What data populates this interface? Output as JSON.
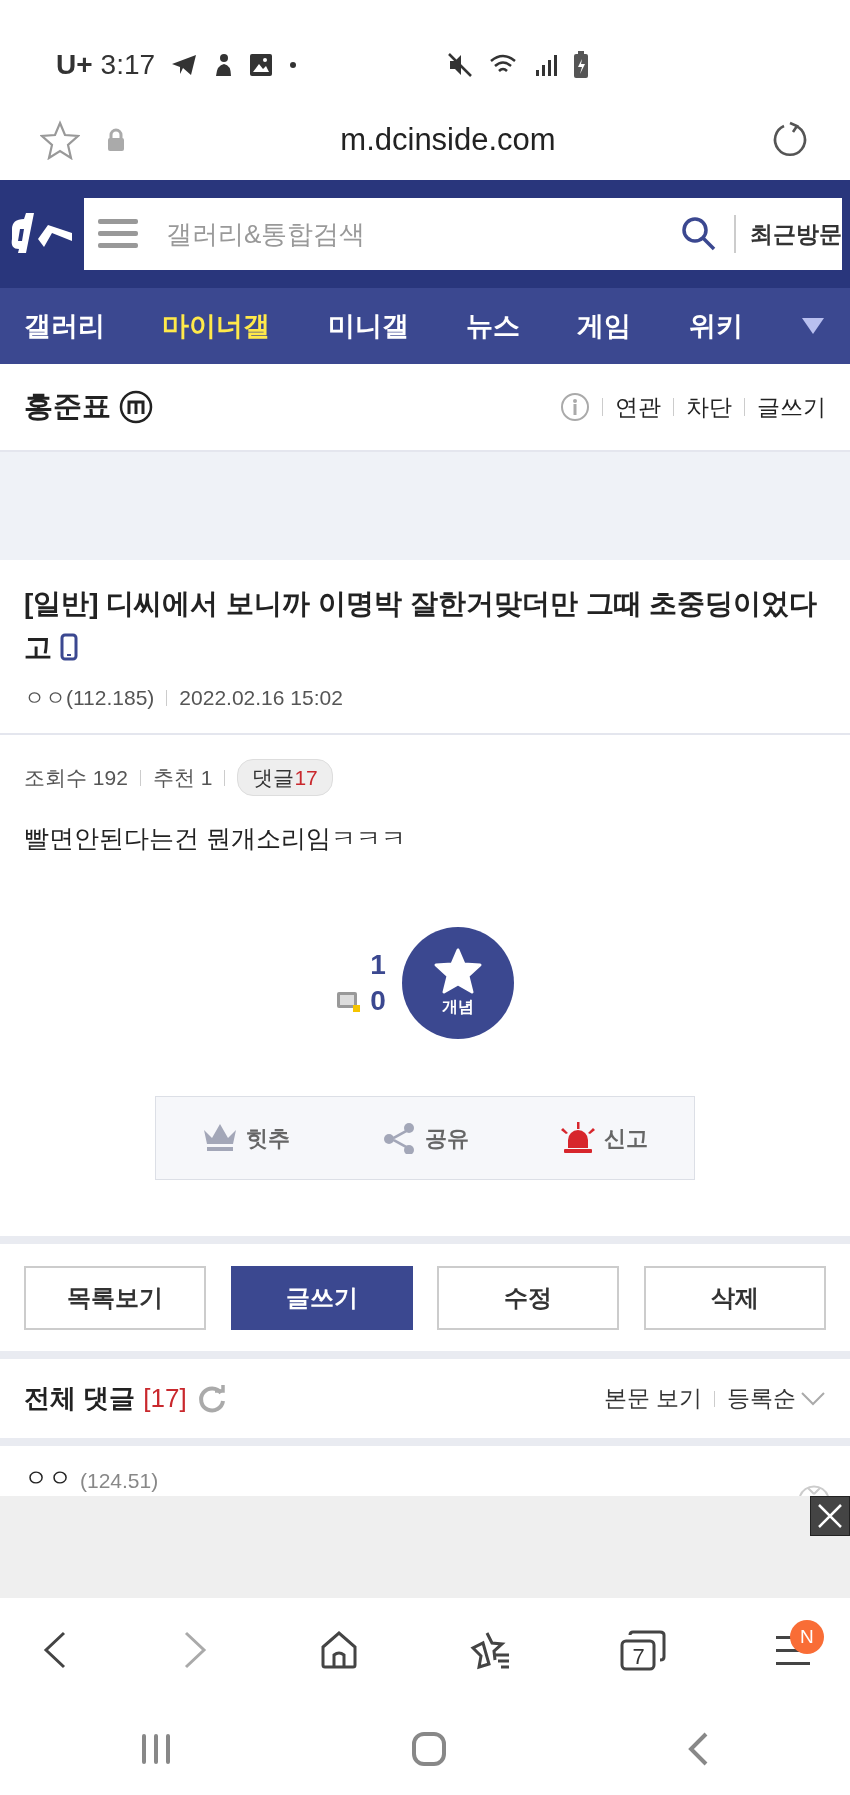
{
  "status_bar": {
    "carrier": "U+",
    "time": "3:17"
  },
  "url_bar": {
    "url": "m.dcinside.com"
  },
  "search": {
    "placeholder": "갤러리&통합검색",
    "recent_button": "최근방문"
  },
  "nav_tabs": [
    {
      "label": "갤러리",
      "selected": false
    },
    {
      "label": "마이너갤",
      "selected": true
    },
    {
      "label": "미니갤",
      "selected": false
    },
    {
      "label": "뉴스",
      "selected": false
    },
    {
      "label": "게임",
      "selected": false
    },
    {
      "label": "위키",
      "selected": false
    }
  ],
  "gallery": {
    "name": "홍준표",
    "links": [
      "연관",
      "차단",
      "글쓰기"
    ]
  },
  "post": {
    "head": "[일반]",
    "title": "디씨에서 보니까 이명박 잘한거맞더만 그때 초중딩이었다고",
    "author": "ㅇㅇ(112.185)",
    "date": "2022.02.16 15:02",
    "views": "조회수 192",
    "recommend": "추천 1",
    "comment_label": "댓글",
    "comment_count": "17",
    "body": "빨면안된다는건 뭔개소리임ㅋㅋㅋ"
  },
  "vote": {
    "up_count": "1",
    "fixed_count": "0",
    "button_label": "개념"
  },
  "actions": [
    {
      "kind": "crown",
      "label": "힛추"
    },
    {
      "kind": "share",
      "label": "공유"
    },
    {
      "kind": "siren",
      "label": "신고"
    }
  ],
  "buttons": [
    {
      "label": "목록보기",
      "kind": "outline"
    },
    {
      "label": "글쓰기",
      "kind": "primary"
    },
    {
      "label": "수정",
      "kind": "outline"
    },
    {
      "label": "삭제",
      "kind": "outline"
    }
  ],
  "comments": {
    "title": "전체 댓글",
    "count": "[17]",
    "view_body": "본문 보기",
    "sort": "등록순"
  },
  "comment_rows": [
    {
      "author": "ㅇㅇ",
      "ip": "(124.51)"
    }
  ],
  "browser_bar": {
    "tab_count": "7",
    "menu_badge": "N"
  }
}
